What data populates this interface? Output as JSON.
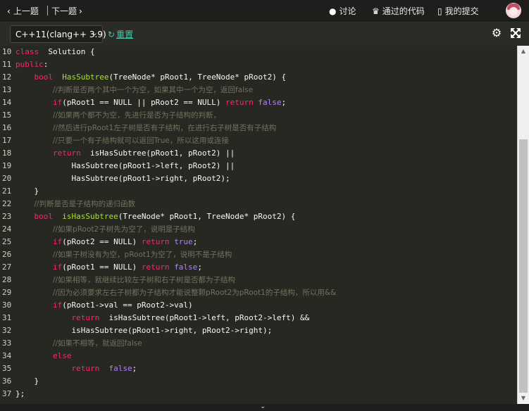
{
  "topbar": {
    "prev_label": "上一题",
    "next_label": "下一题",
    "discuss_label": "讨论",
    "passed_label": "通过的代码",
    "mysub_label": "我的提交"
  },
  "toolbar": {
    "language": "C++11(clang++ 3.9)",
    "reset_label": "重置"
  },
  "colors": {
    "keyword": "#f92672",
    "function": "#a6e22e",
    "comment": "#75715e",
    "constant": "#ae81ff",
    "reset": "#3fc9a8"
  },
  "code_lines": [
    {
      "n": "10",
      "t": [
        [
          "k",
          "class "
        ],
        [
          "p",
          " Solution {"
        ]
      ]
    },
    {
      "n": "11",
      "t": [
        [
          "k",
          "public"
        ],
        [
          "p",
          ":"
        ]
      ]
    },
    {
      "n": "12",
      "t": [
        [
          "p",
          "    "
        ],
        [
          "k",
          "bool "
        ],
        [
          "f",
          " HasSubtree"
        ],
        [
          "p",
          "(TreeNode* pRoot1, TreeNode* pRoot2) {"
        ]
      ]
    },
    {
      "n": "13",
      "t": [
        [
          "p",
          "        "
        ],
        [
          "c",
          "//判断是否两个其中一个为空，如果其中一个为空，返回false"
        ]
      ]
    },
    {
      "n": "14",
      "t": [
        [
          "p",
          "        "
        ],
        [
          "k",
          "if"
        ],
        [
          "p",
          "(pRoot1 == NULL || pRoot2 == NULL) "
        ],
        [
          "k",
          "return "
        ],
        [
          "v",
          "false"
        ],
        [
          "p",
          ";"
        ]
      ]
    },
    {
      "n": "15",
      "t": [
        [
          "p",
          "        "
        ],
        [
          "c",
          "//如果两个都不为空，先进行是否为子结构的判断，"
        ]
      ]
    },
    {
      "n": "16",
      "t": [
        [
          "p",
          "        "
        ],
        [
          "c",
          "//然后进行pRoot1左子树是否有子结构，在进行右子树是否有子结构"
        ]
      ]
    },
    {
      "n": "17",
      "t": [
        [
          "p",
          "        "
        ],
        [
          "c",
          "//只要一个有子结构就可以返回True，所以这用或连接"
        ]
      ]
    },
    {
      "n": "18",
      "t": [
        [
          "p",
          "        "
        ],
        [
          "k",
          "return "
        ],
        [
          "p",
          " isHasSubtree(pRoot1, pRoot2) ||"
        ]
      ]
    },
    {
      "n": "19",
      "t": [
        [
          "p",
          "            HasSubtree(pRoot1->left, pRoot2) ||"
        ]
      ]
    },
    {
      "n": "20",
      "t": [
        [
          "p",
          "            HasSubtree(pRoot1->right, pRoot2);"
        ]
      ]
    },
    {
      "n": "21",
      "t": [
        [
          "p",
          "    }"
        ]
      ]
    },
    {
      "n": "22",
      "t": [
        [
          "p",
          "    "
        ],
        [
          "c",
          "//判断是否是子结构的递归函数"
        ]
      ]
    },
    {
      "n": "23",
      "t": [
        [
          "p",
          "    "
        ],
        [
          "k",
          "bool "
        ],
        [
          "f",
          " isHasSubtree"
        ],
        [
          "p",
          "(TreeNode* pRoot1, TreeNode* pRoot2) {"
        ]
      ]
    },
    {
      "n": "24",
      "t": [
        [
          "p",
          "        "
        ],
        [
          "c",
          "//如果pRoot2子树先为空了，说明是子结构"
        ]
      ]
    },
    {
      "n": "25",
      "t": [
        [
          "p",
          "        "
        ],
        [
          "k",
          "if"
        ],
        [
          "p",
          "(pRoot2 == NULL) "
        ],
        [
          "k",
          "return "
        ],
        [
          "v",
          "true"
        ],
        [
          "p",
          ";"
        ]
      ]
    },
    {
      "n": "26",
      "t": [
        [
          "p",
          "        "
        ],
        [
          "c",
          "//如果子树没有为空，pRoot1为空了，说明不是子结构"
        ]
      ]
    },
    {
      "n": "27",
      "t": [
        [
          "p",
          "        "
        ],
        [
          "k",
          "if"
        ],
        [
          "p",
          "(pRoot1 == NULL) "
        ],
        [
          "k",
          "return "
        ],
        [
          "v",
          "false"
        ],
        [
          "p",
          ";"
        ]
      ]
    },
    {
      "n": "28",
      "t": [
        [
          "p",
          "        "
        ],
        [
          "c",
          "//如果相等，就继续比较左子树和右子树是否都为子结构"
        ]
      ]
    },
    {
      "n": "29",
      "t": [
        [
          "p",
          "        "
        ],
        [
          "c",
          "//因为必须要求左右子树都为子结构才能说整颗pRoot2为pRoot1的子结构，所以用&&"
        ]
      ]
    },
    {
      "n": "30",
      "t": [
        [
          "p",
          "        "
        ],
        [
          "k",
          "if"
        ],
        [
          "p",
          "(pRoot1->val == pRoot2->val)"
        ]
      ]
    },
    {
      "n": "31",
      "t": [
        [
          "p",
          "            "
        ],
        [
          "k",
          "return "
        ],
        [
          "p",
          " isHasSubtree(pRoot1->left, pRoot2->left) &&"
        ]
      ]
    },
    {
      "n": "32",
      "t": [
        [
          "p",
          "            isHasSubtree(pRoot1->right, pRoot2->right);"
        ]
      ]
    },
    {
      "n": "33",
      "t": [
        [
          "p",
          "        "
        ],
        [
          "c",
          "//如果不相等，就返回false"
        ]
      ]
    },
    {
      "n": "34",
      "t": [
        [
          "p",
          "        "
        ],
        [
          "k",
          "else"
        ]
      ]
    },
    {
      "n": "35",
      "t": [
        [
          "p",
          "            "
        ],
        [
          "k",
          "return "
        ],
        [
          "v",
          " false"
        ],
        [
          "p",
          ";"
        ]
      ]
    },
    {
      "n": "36",
      "t": [
        [
          "p",
          "    }"
        ]
      ]
    },
    {
      "n": "37",
      "t": [
        [
          "p",
          "};"
        ]
      ]
    }
  ]
}
